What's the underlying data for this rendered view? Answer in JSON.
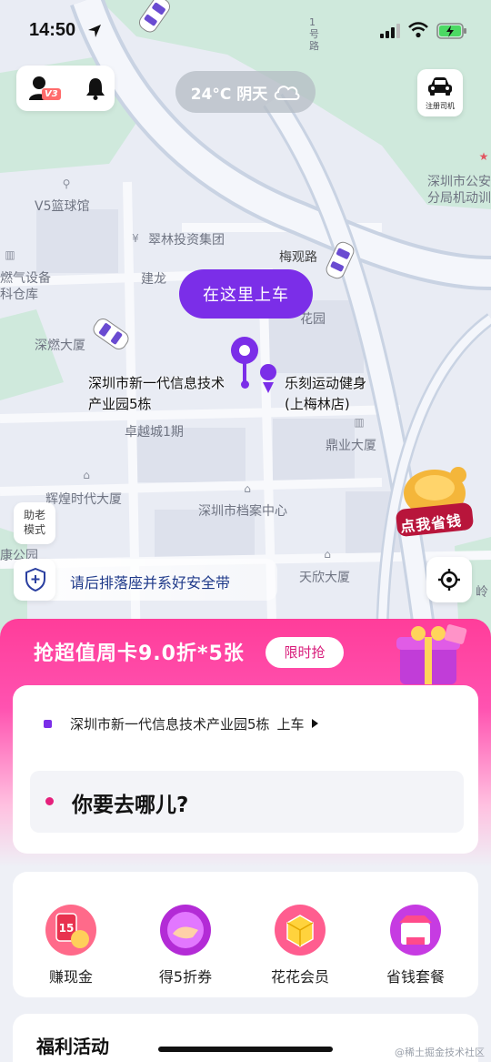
{
  "status_bar": {
    "time": "14:50"
  },
  "top": {
    "user_badge": "V3",
    "weather_text": "24°C 阴天",
    "driver_label": "注册司机"
  },
  "map": {
    "labels": {
      "v5": "V5篮球馆",
      "cuilin": "翠林投资集团",
      "meiguan": "梅观路",
      "jianlong": "建龙",
      "huayuan": "花园",
      "shenran": "深燃大厦",
      "ranqi": "燃气设备",
      "cangku": "科仓库",
      "zhuoyue": "卓越城1期",
      "dingye": "鼎业大厦",
      "huihuang": "辉煌时代大厦",
      "dangan": "深圳市档案中心",
      "tianxin": "天欣大厦",
      "police_1": "深圳市公安",
      "police_2": "分局机动训",
      "lu_fragment": "1 号 路",
      "gongyuan": "康公园",
      "ling": "岭"
    },
    "pickup_bubble": "在这里上车",
    "pickup_poi": "深圳市新一代信息技术产业园5栋",
    "nearby_poi": "乐刻运动健身(上梅林店)",
    "elder_mode": "助老模式",
    "promo_badge": "点我省钱",
    "safety_tip": "请后排落座并系好安全带"
  },
  "sheet": {
    "promo_title": "抢超值周卡9.0折*5张",
    "limited_btn": "限时抢",
    "from_address": "深圳市新一代信息技术产业园5栋",
    "from_suffix": "上车",
    "to_placeholder": "你要去哪儿?",
    "quick_items": [
      {
        "label": "赚现金",
        "icon": "cash-icon"
      },
      {
        "label": "得5折券",
        "icon": "coupon-icon"
      },
      {
        "label": "花花会员",
        "icon": "member-icon"
      },
      {
        "label": "省钱套餐",
        "icon": "package-icon"
      }
    ],
    "welfare_title": "福利活动"
  },
  "watermark": "@稀土掘金技术社区",
  "colors": {
    "accent": "#7b2ee8",
    "pink": "#ff3d9a",
    "destination_dot": "#e5207c"
  }
}
